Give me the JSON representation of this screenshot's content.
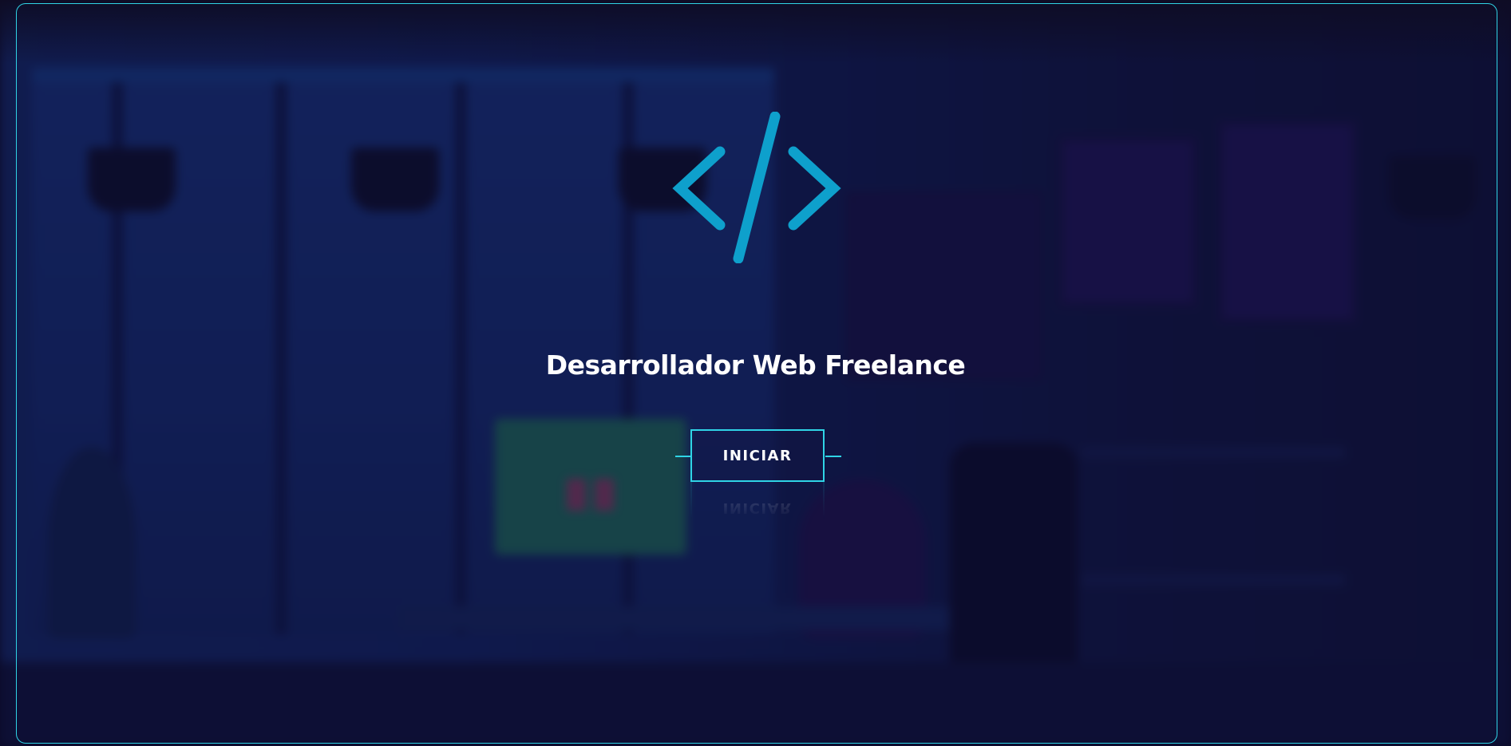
{
  "hero": {
    "title": "Desarrollador Web Freelance",
    "start_button_label": "INICIAR",
    "logo_icon": "code-brackets-icon"
  },
  "colors": {
    "accent": "#2fd4e6",
    "logo": "#0ea0cc",
    "text": "#ffffff"
  }
}
